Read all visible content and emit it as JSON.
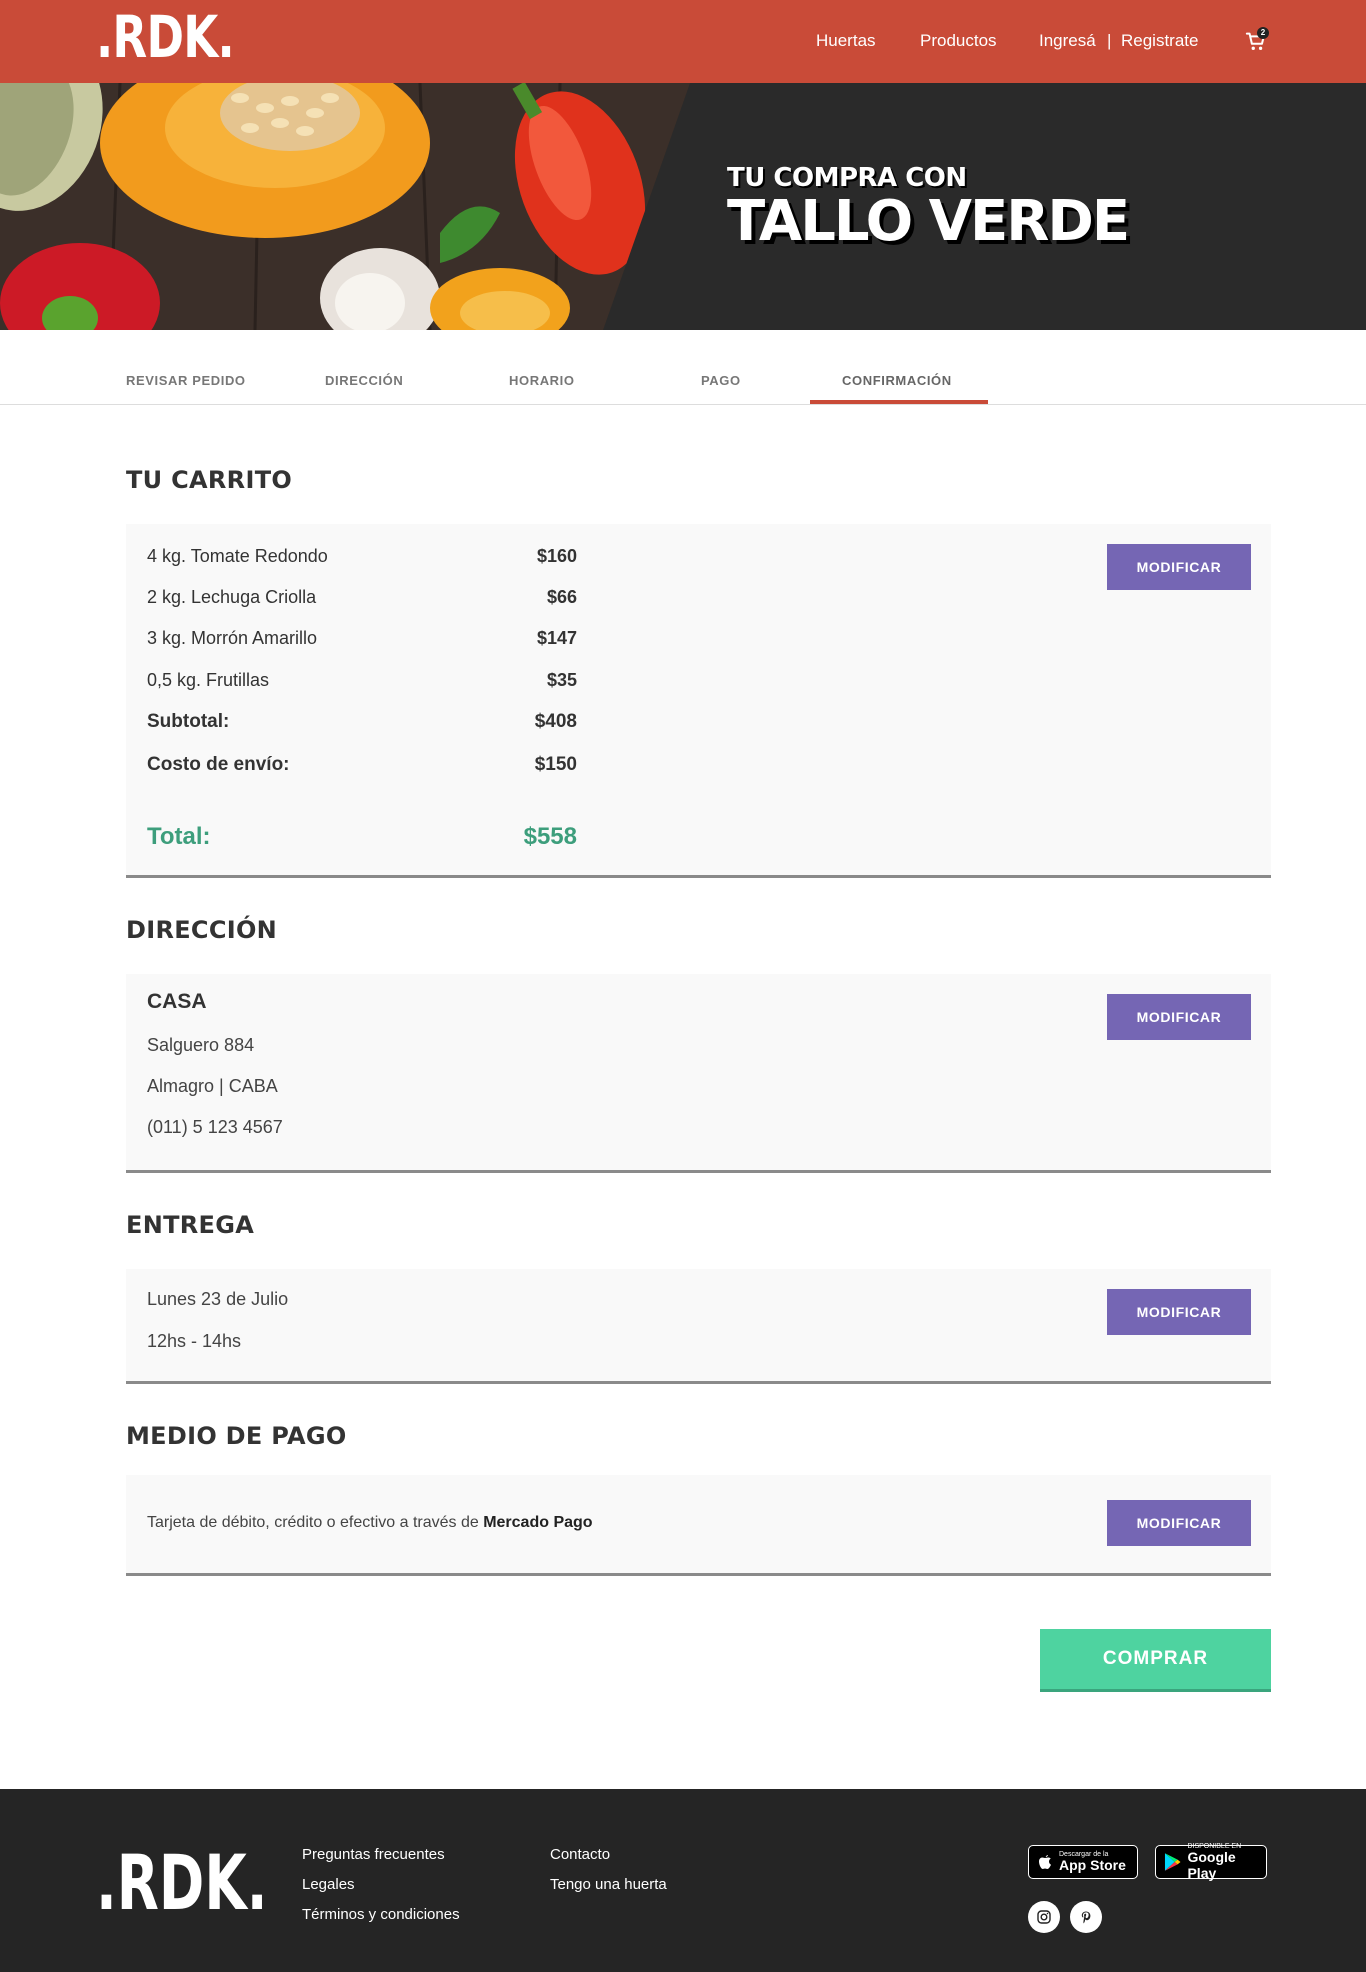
{
  "header": {
    "logo": ".RDK.",
    "nav": {
      "huertas": "Huertas",
      "productos": "Productos",
      "ingresa": "Ingresá",
      "separator": "|",
      "registrate": "Registrate"
    },
    "cart_count": "2",
    "cart_icon": "cart-icon"
  },
  "hero": {
    "subtitle": "TU COMPRA CON",
    "title": "TALLO VERDE"
  },
  "steps": [
    "REVISAR PEDIDO",
    "DIRECCIÓN",
    "HORARIO",
    "PAGO",
    "CONFIRMACIÓN"
  ],
  "active_step": "CONFIRMACIÓN",
  "cart": {
    "title": "TU CARRITO",
    "items": [
      {
        "label": "4 kg.  Tomate Redondo",
        "price": "$160"
      },
      {
        "label": "2 kg.  Lechuga Criolla",
        "price": "$66"
      },
      {
        "label": "3 kg.  Morrón Amarillo",
        "price": "$147"
      },
      {
        "label": "0,5 kg.  Frutillas",
        "price": "$35"
      }
    ],
    "subtotal_label": "Subtotal:",
    "subtotal": "$408",
    "shipping_label": "Costo de envío:",
    "shipping": "$150",
    "total_label": "Total:",
    "total": "$558",
    "modify": "MODIFICAR"
  },
  "address": {
    "title": "DIRECCIÓN",
    "name": "CASA",
    "street": "Salguero 884",
    "area": "Almagro  |  CABA",
    "phone": "(011) 5 123 4567",
    "modify": "MODIFICAR"
  },
  "delivery": {
    "title": "ENTREGA",
    "date": "Lunes 23 de Julio",
    "time": "12hs - 14hs",
    "modify": "MODIFICAR"
  },
  "payment": {
    "title": "MEDIO DE PAGO",
    "text": "Tarjeta de débito, crédito o efectivo a través de ",
    "provider": "Mercado Pago",
    "modify": "MODIFICAR"
  },
  "buy_label": "COMPRAR",
  "colors": {
    "brand": "#c94b38",
    "accent": "#7566b4",
    "buy": "#4ed3a0",
    "total": "#3d9e7c",
    "dark": "#252525"
  },
  "footer": {
    "logo": ".RDK.",
    "links_col1": [
      "Preguntas frecuentes",
      "Legales",
      "Términos y condiciones"
    ],
    "links_col2": [
      "Contacto",
      "Tengo una huerta"
    ],
    "app_store_small": "Descargar de la",
    "app_store": "App Store",
    "google_play_small": "DISPONIBLE EN",
    "google_play": "Google Play",
    "social_icons": [
      "instagram-icon",
      "pinterest-icon"
    ]
  }
}
